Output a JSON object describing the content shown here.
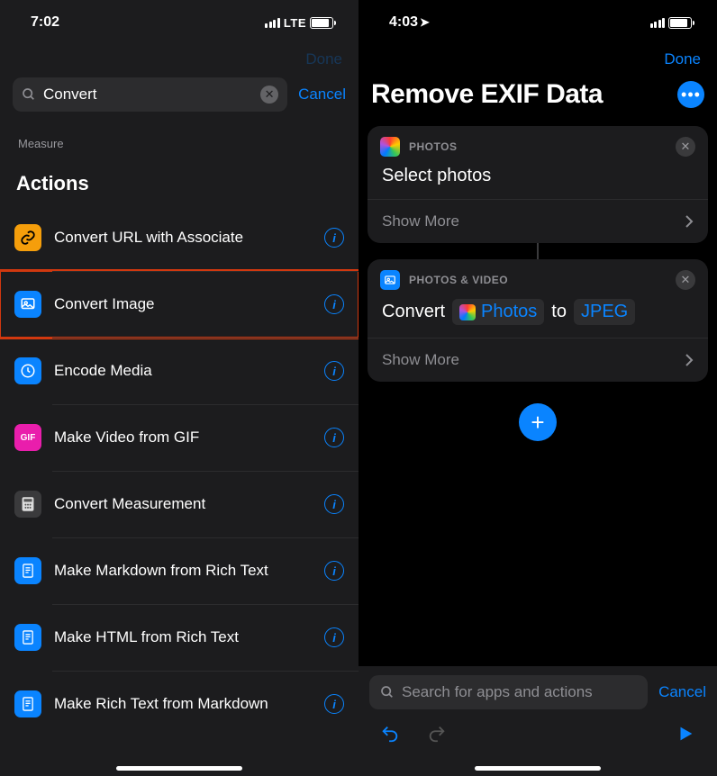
{
  "left": {
    "status": {
      "time": "7:02",
      "network": "LTE"
    },
    "top_done": "Done",
    "search": {
      "value": "Convert",
      "cancel": "Cancel"
    },
    "sub_label": "Measure",
    "section_title": "Actions",
    "actions": [
      {
        "label": "Convert URL with Associate",
        "icon_color": "#f59e0b",
        "icon": "link"
      },
      {
        "label": "Convert Image",
        "icon_color": "#0a84ff",
        "icon": "image",
        "highlighted": true
      },
      {
        "label": "Encode Media",
        "icon_color": "#0a84ff",
        "icon": "clock"
      },
      {
        "label": "Make Video from GIF",
        "icon_color": "#e91eac",
        "icon": "gif"
      },
      {
        "label": "Convert Measurement",
        "icon_color": "#48484a",
        "icon": "calculator"
      },
      {
        "label": "Make Markdown from Rich Text",
        "icon_color": "#0a84ff",
        "icon": "doc"
      },
      {
        "label": "Make HTML from Rich Text",
        "icon_color": "#0a84ff",
        "icon": "doc"
      },
      {
        "label": "Make Rich Text from Markdown",
        "icon_color": "#0a84ff",
        "icon": "doc"
      }
    ]
  },
  "right": {
    "status": {
      "time": "4:03"
    },
    "top_done": "Done",
    "title": "Remove EXIF Data",
    "cards": [
      {
        "category": "PHOTOS",
        "app": "photos",
        "body_text": "Select photos",
        "show_more": "Show More"
      },
      {
        "category": "PHOTOS & VIDEO",
        "app": "photos_video",
        "convert_prefix": "Convert",
        "param1": "Photos",
        "to_text": "to",
        "param2": "JPEG",
        "show_more": "Show More"
      }
    ],
    "search_placeholder": "Search for apps and actions",
    "cancel": "Cancel"
  }
}
